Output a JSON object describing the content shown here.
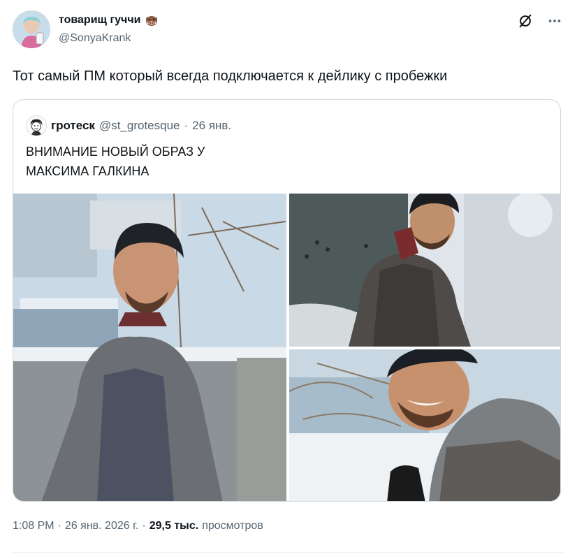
{
  "author": {
    "display_name": "товарищ гуччи",
    "badge_icon": "boar-emoji",
    "handle": "@SonyaKrank"
  },
  "header_actions": {
    "grok_icon": "grok-icon",
    "more_icon": "more-dots-icon"
  },
  "tweet": {
    "text": "Тот самый ПМ который всегда подключается к дейлику с пробежки"
  },
  "quote": {
    "display_name": "гротеск",
    "handle": "@st_grotesque",
    "separator": "·",
    "date": "26 янв.",
    "text_lines": [
      "ВНИМАНИЕ НОВЫЙ ОБРАЗ У",
      "МАКСИМА ГАЛКИНА"
    ]
  },
  "meta": {
    "time": "1:08 PM",
    "sep1": "·",
    "date": "26 янв. 2026 г.",
    "sep2": "·",
    "views_count": "29,5 тыс.",
    "views_label": "просмотров"
  },
  "colors": {
    "text": "#0f1419",
    "secondary": "#536471",
    "border": "#cfd9de"
  }
}
